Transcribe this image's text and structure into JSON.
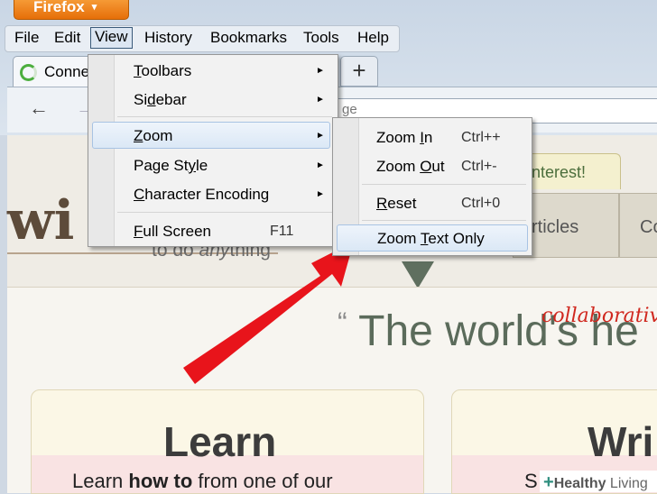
{
  "firefox_button": {
    "label": "Firefox",
    "caret": "▾"
  },
  "menubar": {
    "items": [
      "File",
      "Edit",
      "View",
      "History",
      "Bookmarks",
      "Tools",
      "Help"
    ]
  },
  "tab": {
    "title": "Conne",
    "new_tab": "+"
  },
  "nav": {
    "back": "←",
    "forward": "→",
    "url_fragment": "ge"
  },
  "view_menu": {
    "items": [
      {
        "label": "Toolbars",
        "arrow": "►"
      },
      {
        "label": "Sidebar",
        "arrow": "►"
      },
      {
        "label": "Zoom",
        "arrow": "►"
      },
      {
        "label": "Page Style",
        "arrow": "►"
      },
      {
        "label": "Character Encoding",
        "arrow": "►"
      },
      {
        "label": "Full Screen",
        "shortcut": "F11"
      }
    ]
  },
  "zoom_menu": {
    "items": [
      {
        "label": "Zoom In",
        "shortcut": "Ctrl++"
      },
      {
        "label": "Zoom Out",
        "shortcut": "Ctrl+-"
      },
      {
        "label": "Reset",
        "shortcut": "Ctrl+0"
      },
      {
        "label": "Zoom Text Only"
      }
    ]
  },
  "page": {
    "logo": "wi",
    "tagline_pre": "to do ",
    "tagline_em": "any",
    "tagline_post": "thing",
    "interest": "nterest!",
    "tab_articles": "rticles",
    "tab_co": "Co",
    "quote_mark": "“",
    "quote": "The world's he",
    "annotation": "collaborativ",
    "card_learn": {
      "title": "Learn",
      "sub_pre": "Learn ",
      "sub_bold": "how to",
      "sub_post": " from one of our"
    },
    "card_write": {
      "title": "Wri",
      "sub": "S"
    },
    "watermark": {
      "plus": "+",
      "healthy": "Healthy",
      "living": " Living"
    }
  },
  "colors": {
    "firefox_orange": "#e66f09",
    "arrow_red": "#e8141b",
    "hover_blue": "#dbe8f6"
  }
}
